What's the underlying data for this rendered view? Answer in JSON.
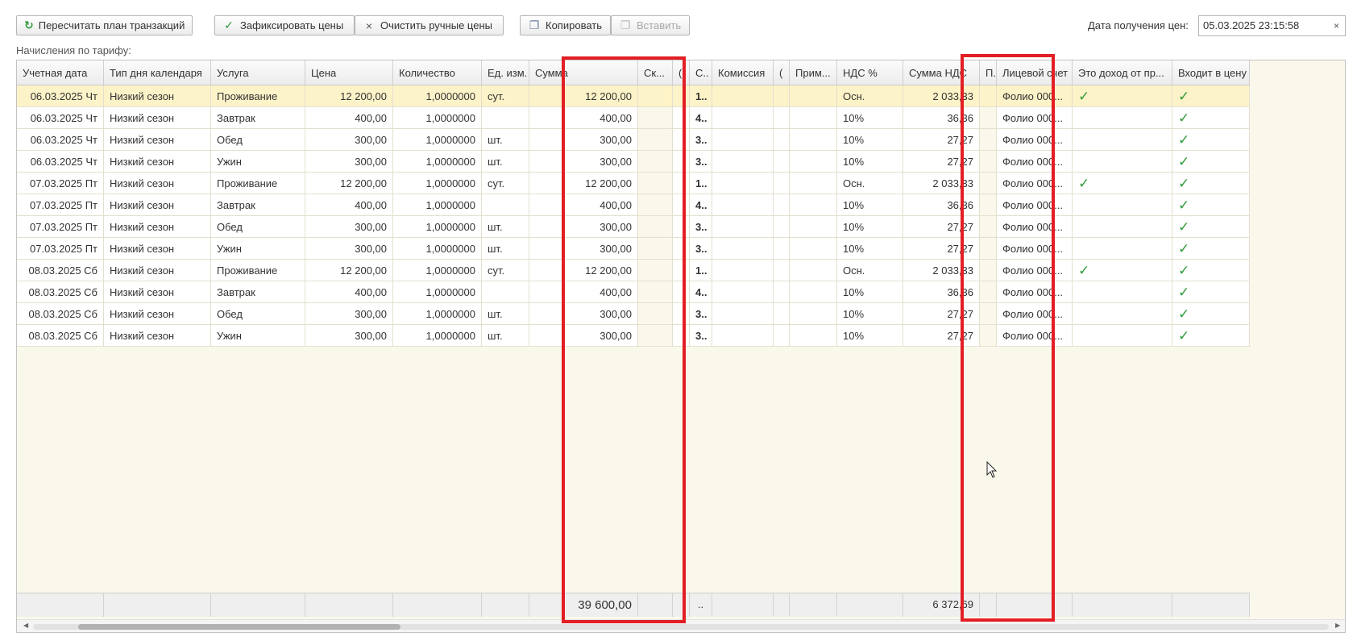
{
  "toolbar": {
    "recalc_label": "Пересчитать план транзакций",
    "fix_prices_label": "Зафиксировать цены",
    "clear_manual_label": "Очистить ручные цены",
    "copy_label": "Копировать",
    "paste_label": "Вставить",
    "date_label": "Дата получения цен:",
    "date_value": "05.03.2025 23:15:58",
    "date_clear": "×"
  },
  "section_label": "Начисления по тарифу:",
  "columns": [
    "Учетная дата",
    "Тип дня календаря",
    "Услуга",
    "Цена",
    "Количество",
    "Ед. изм.",
    "Сумма",
    "Ск...",
    "(",
    "С..",
    "Комиссия",
    "(",
    "Прим...",
    "НДС %",
    "Сумма НДС",
    "П..",
    "Лицевой счет",
    "Это доход от пр...",
    "Входит в цену"
  ],
  "rows": [
    {
      "date": "06.03.2025 Чт",
      "daytype": "Низкий сезон",
      "service": "Проживание",
      "price": "12 200,00",
      "qty": "1,0000000",
      "unit": "сут.",
      "sum": "12 200,00",
      "c": "1..",
      "vat_pct": "Осн.",
      "vat_sum": "2 033,33",
      "account": "Фолио 000...",
      "income": true,
      "in_price": true
    },
    {
      "date": "06.03.2025 Чт",
      "daytype": "Низкий сезон",
      "service": "Завтрак",
      "price": "400,00",
      "qty": "1,0000000",
      "unit": "",
      "sum": "400,00",
      "c": "4..",
      "vat_pct": "10%",
      "vat_sum": "36,36",
      "account": "Фолио 000...",
      "income": false,
      "in_price": true
    },
    {
      "date": "06.03.2025 Чт",
      "daytype": "Низкий сезон",
      "service": "Обед",
      "price": "300,00",
      "qty": "1,0000000",
      "unit": "шт.",
      "sum": "300,00",
      "c": "3..",
      "vat_pct": "10%",
      "vat_sum": "27,27",
      "account": "Фолио 000...",
      "income": false,
      "in_price": true
    },
    {
      "date": "06.03.2025 Чт",
      "daytype": "Низкий сезон",
      "service": "Ужин",
      "price": "300,00",
      "qty": "1,0000000",
      "unit": "шт.",
      "sum": "300,00",
      "c": "3..",
      "vat_pct": "10%",
      "vat_sum": "27,27",
      "account": "Фолио 000...",
      "income": false,
      "in_price": true
    },
    {
      "date": "07.03.2025 Пт",
      "daytype": "Низкий сезон",
      "service": "Проживание",
      "price": "12 200,00",
      "qty": "1,0000000",
      "unit": "сут.",
      "sum": "12 200,00",
      "c": "1..",
      "vat_pct": "Осн.",
      "vat_sum": "2 033,33",
      "account": "Фолио 000...",
      "income": true,
      "in_price": true
    },
    {
      "date": "07.03.2025 Пт",
      "daytype": "Низкий сезон",
      "service": "Завтрак",
      "price": "400,00",
      "qty": "1,0000000",
      "unit": "",
      "sum": "400,00",
      "c": "4..",
      "vat_pct": "10%",
      "vat_sum": "36,36",
      "account": "Фолио 000...",
      "income": false,
      "in_price": true
    },
    {
      "date": "07.03.2025 Пт",
      "daytype": "Низкий сезон",
      "service": "Обед",
      "price": "300,00",
      "qty": "1,0000000",
      "unit": "шт.",
      "sum": "300,00",
      "c": "3..",
      "vat_pct": "10%",
      "vat_sum": "27,27",
      "account": "Фолио 000...",
      "income": false,
      "in_price": true
    },
    {
      "date": "07.03.2025 Пт",
      "daytype": "Низкий сезон",
      "service": "Ужин",
      "price": "300,00",
      "qty": "1,0000000",
      "unit": "шт.",
      "sum": "300,00",
      "c": "3..",
      "vat_pct": "10%",
      "vat_sum": "27,27",
      "account": "Фолио 000...",
      "income": false,
      "in_price": true
    },
    {
      "date": "08.03.2025 Сб",
      "daytype": "Низкий сезон",
      "service": "Проживание",
      "price": "12 200,00",
      "qty": "1,0000000",
      "unit": "сут.",
      "sum": "12 200,00",
      "c": "1..",
      "vat_pct": "Осн.",
      "vat_sum": "2 033,33",
      "account": "Фолио 000...",
      "income": true,
      "in_price": true
    },
    {
      "date": "08.03.2025 Сб",
      "daytype": "Низкий сезон",
      "service": "Завтрак",
      "price": "400,00",
      "qty": "1,0000000",
      "unit": "",
      "sum": "400,00",
      "c": "4..",
      "vat_pct": "10%",
      "vat_sum": "36,36",
      "account": "Фолио 000...",
      "income": false,
      "in_price": true
    },
    {
      "date": "08.03.2025 Сб",
      "daytype": "Низкий сезон",
      "service": "Обед",
      "price": "300,00",
      "qty": "1,0000000",
      "unit": "шт.",
      "sum": "300,00",
      "c": "3..",
      "vat_pct": "10%",
      "vat_sum": "27,27",
      "account": "Фолио 000...",
      "income": false,
      "in_price": true
    },
    {
      "date": "08.03.2025 Сб",
      "daytype": "Низкий сезон",
      "service": "Ужин",
      "price": "300,00",
      "qty": "1,0000000",
      "unit": "шт.",
      "sum": "300,00",
      "c": "3..",
      "vat_pct": "10%",
      "vat_sum": "27,27",
      "account": "Фолио 000...",
      "income": false,
      "in_price": true
    }
  ],
  "totals": {
    "sum": "39 600,00",
    "c": "..",
    "vat_sum": "6 372,69"
  },
  "icons": {
    "check": "✓",
    "refresh": "↻",
    "close": "×"
  },
  "colors": {
    "selected_row": "#fdf3c8",
    "service_col_bg": "#fdf3c8",
    "highlight_frame": "#e31e24",
    "check": "#2e9b3a",
    "grid_bg": "#faf8ea"
  }
}
